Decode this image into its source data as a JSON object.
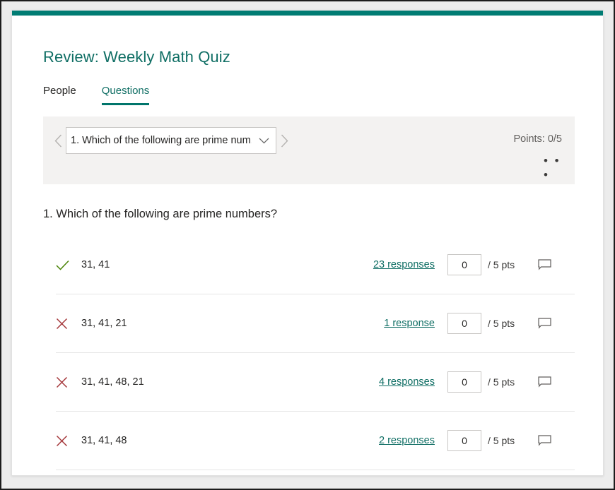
{
  "window": {
    "accent_color": "#007c73"
  },
  "header": {
    "title": "Review: Weekly Math Quiz"
  },
  "tabs": [
    {
      "label": "People",
      "active": false
    },
    {
      "label": "Questions",
      "active": true
    }
  ],
  "navigator": {
    "prev_icon": "chevron-left-icon",
    "next_icon": "chevron-right-icon",
    "selected_question": "1. Which of the following are prime num...",
    "caret_icon": "chevron-down-icon",
    "points_label": "Points: 0/5",
    "more_label": "• • •"
  },
  "question": {
    "heading": "1. Which of the following are prime numbers?",
    "options": [
      {
        "correct": true,
        "status_icon": "check-icon",
        "text": "31, 41",
        "responses_label": "23 responses",
        "score_value": "0",
        "score_suffix": "/ 5 pts",
        "comment_icon": "comment-icon"
      },
      {
        "correct": false,
        "status_icon": "cross-icon",
        "text": "31, 41, 21",
        "responses_label": "1 response",
        "score_value": "0",
        "score_suffix": "/ 5 pts",
        "comment_icon": "comment-icon"
      },
      {
        "correct": false,
        "status_icon": "cross-icon",
        "text": "31, 41, 48, 21",
        "responses_label": "4 responses",
        "score_value": "0",
        "score_suffix": "/ 5 pts",
        "comment_icon": "comment-icon"
      },
      {
        "correct": false,
        "status_icon": "cross-icon",
        "text": "31, 41, 48",
        "responses_label": "2 responses",
        "score_value": "0",
        "score_suffix": "/ 5 pts",
        "comment_icon": "comment-icon"
      }
    ]
  },
  "colors": {
    "accent": "#007c73",
    "link": "#0f6e64",
    "correct": "#498205",
    "incorrect": "#a4373a",
    "panel_bg": "#f3f2f1"
  }
}
